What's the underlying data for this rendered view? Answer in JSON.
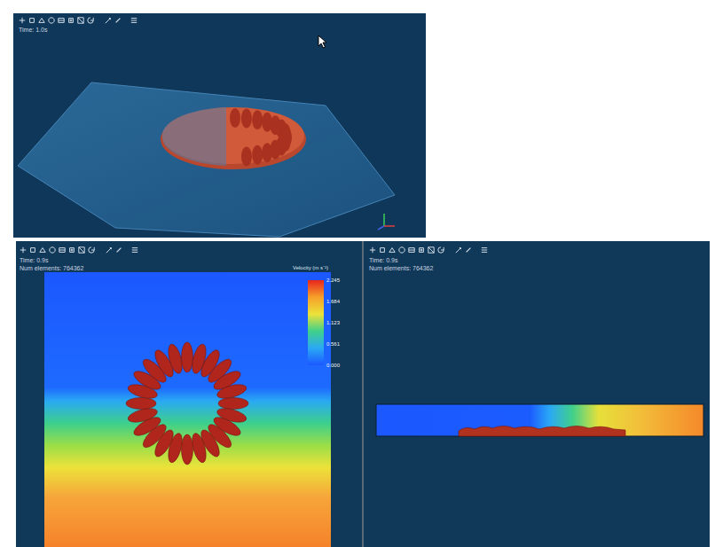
{
  "viewports": [
    {
      "name": "perspective",
      "time": "Time: 1.0s"
    },
    {
      "name": "top",
      "time": "Time: 0.9s",
      "elements": "Num elements: 764362",
      "legend": {
        "title": "Velocity (m s⁻¹)",
        "ticks": [
          "2.245",
          "1.684",
          "1.123",
          "0.561",
          "0.000"
        ]
      }
    },
    {
      "name": "side",
      "time": "Time: 0.9s",
      "elements": "Num elements: 764362"
    }
  ]
}
